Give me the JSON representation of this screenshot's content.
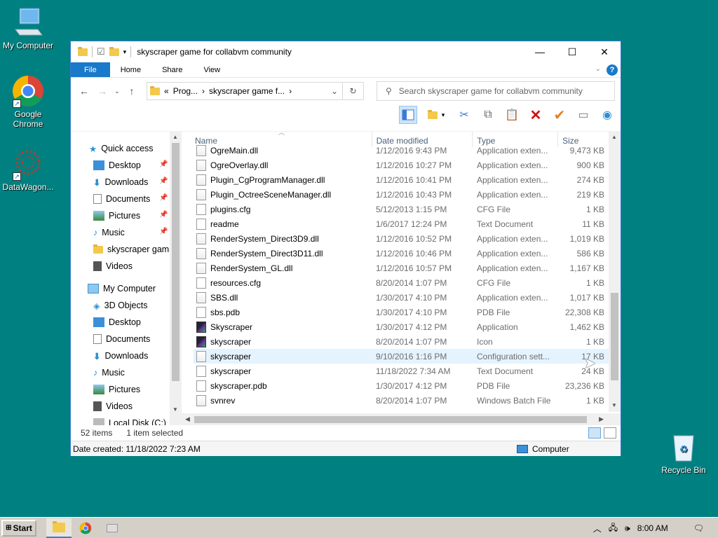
{
  "desktop": {
    "icons": [
      {
        "label": "My Computer"
      },
      {
        "label": "Google Chrome"
      },
      {
        "label": "DataWagon..."
      },
      {
        "label": "Recycle Bin"
      }
    ]
  },
  "window": {
    "title": "skyscraper game for collabvm community",
    "controls": {
      "minimize": "—",
      "maximize": "☐",
      "close": "✕"
    },
    "ribbon_tabs": [
      "File",
      "Home",
      "Share",
      "View"
    ],
    "help_label": "?",
    "address": {
      "crumbs": [
        "«",
        "Prog...",
        "›",
        "skyscraper game f...",
        "›"
      ]
    },
    "search": {
      "placeholder": "Search skyscraper game for collabvm community"
    },
    "nav": {
      "quick_access": "Quick access",
      "quick_items": [
        "Desktop",
        "Downloads",
        "Documents",
        "Pictures",
        "Music",
        "skyscraper game",
        "Videos"
      ],
      "this_pc": "My Computer",
      "pc_items": [
        "3D Objects",
        "Desktop",
        "Documents",
        "Downloads",
        "Music",
        "Pictures",
        "Videos",
        "Local Disk (C:)"
      ]
    },
    "columns": {
      "name": "Name",
      "date": "Date modified",
      "type": "Type",
      "size": "Size"
    },
    "files": [
      {
        "name": "OgreMain.dll",
        "date": "1/12/2016 9:43 PM",
        "type": "Application exten...",
        "size": "9,473 KB",
        "icon": "cfg"
      },
      {
        "name": "OgreOverlay.dll",
        "date": "1/12/2016 10:27 PM",
        "type": "Application exten...",
        "size": "900 KB",
        "icon": "cfg"
      },
      {
        "name": "Plugin_CgProgramManager.dll",
        "date": "1/12/2016 10:41 PM",
        "type": "Application exten...",
        "size": "274 KB",
        "icon": "cfg"
      },
      {
        "name": "Plugin_OctreeSceneManager.dll",
        "date": "1/12/2016 10:43 PM",
        "type": "Application exten...",
        "size": "219 KB",
        "icon": "cfg"
      },
      {
        "name": "plugins.cfg",
        "date": "5/12/2013 1:15 PM",
        "type": "CFG File",
        "size": "1 KB",
        "icon": "doc"
      },
      {
        "name": "readme",
        "date": "1/6/2017 12:24 PM",
        "type": "Text Document",
        "size": "11 KB",
        "icon": "doc"
      },
      {
        "name": "RenderSystem_Direct3D9.dll",
        "date": "1/12/2016 10:52 PM",
        "type": "Application exten...",
        "size": "1,019 KB",
        "icon": "cfg"
      },
      {
        "name": "RenderSystem_Direct3D11.dll",
        "date": "1/12/2016 10:46 PM",
        "type": "Application exten...",
        "size": "586 KB",
        "icon": "cfg"
      },
      {
        "name": "RenderSystem_GL.dll",
        "date": "1/12/2016 10:57 PM",
        "type": "Application exten...",
        "size": "1,167 KB",
        "icon": "cfg"
      },
      {
        "name": "resources.cfg",
        "date": "8/20/2014 1:07 PM",
        "type": "CFG File",
        "size": "1 KB",
        "icon": "doc"
      },
      {
        "name": "SBS.dll",
        "date": "1/30/2017 4:10 PM",
        "type": "Application exten...",
        "size": "1,017 KB",
        "icon": "cfg"
      },
      {
        "name": "sbs.pdb",
        "date": "1/30/2017 4:10 PM",
        "type": "PDB File",
        "size": "22,308 KB",
        "icon": "doc"
      },
      {
        "name": "Skyscraper",
        "date": "1/30/2017 4:12 PM",
        "type": "Application",
        "size": "1,462 KB",
        "icon": "app"
      },
      {
        "name": "skyscraper",
        "date": "8/20/2014 1:07 PM",
        "type": "Icon",
        "size": "1 KB",
        "icon": "app"
      },
      {
        "name": "skyscraper",
        "date": "9/10/2016 1:16 PM",
        "type": "Configuration sett...",
        "size": "17 KB",
        "icon": "cfg",
        "selected": true
      },
      {
        "name": "skyscraper",
        "date": "11/18/2022 7:34 AM",
        "type": "Text Document",
        "size": "24 KB",
        "icon": "doc"
      },
      {
        "name": "skyscraper.pdb",
        "date": "1/30/2017 4:12 PM",
        "type": "PDB File",
        "size": "23,236 KB",
        "icon": "doc"
      },
      {
        "name": "svnrev",
        "date": "8/20/2014 1:07 PM",
        "type": "Windows Batch File",
        "size": "1 KB",
        "icon": "cfg"
      }
    ],
    "status": {
      "items": "52 items",
      "selected": "1 item selected"
    },
    "details": {
      "date_created": "Date created: 11/18/2022 7:23 AM",
      "location": "Computer"
    }
  },
  "taskbar": {
    "start_label": "Start",
    "clock": "8:00 AM"
  }
}
